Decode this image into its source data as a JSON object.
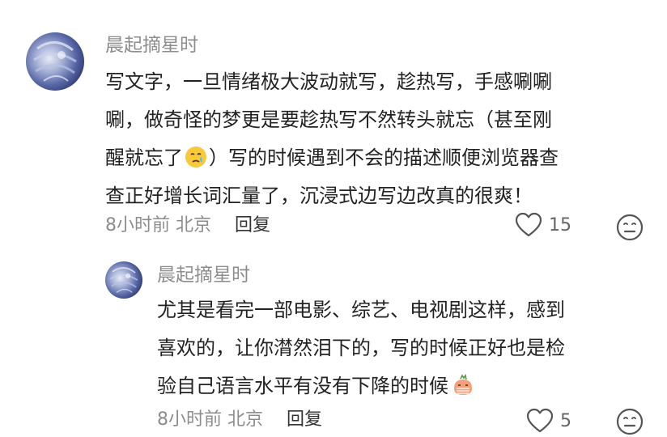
{
  "comment": {
    "username": "晨起摘星时",
    "text_lines": [
      "写文字，一旦情绪极大波动就写，趁热写，手感唰唰",
      "唰，做奇怪的梦更是要趁热写不然转头就忘（甚至刚",
      "醒就忘了",
      "）写的时候遇到不会的描述顺便浏览器查",
      "查正好增长词汇量了，沉浸式边写边改真的很爽！"
    ],
    "inline_emoji": "crying-face-icon",
    "time": "8小时前",
    "location": "北京",
    "reply_label": "回复",
    "like_count": "15"
  },
  "reply": {
    "username": "晨起摘星时",
    "text_lines": [
      "尤其是看完一部电影、综艺、电视剧这样，感到",
      "喜欢的，让你潸然泪下的，写的时候正好也是检",
      "验自己语言水平有没有下降的时候"
    ],
    "inline_emoji": "embarrassed-face-icon",
    "time": "8小时前",
    "location": "北京",
    "reply_label": "回复",
    "like_count": "5"
  },
  "colors": {
    "username": "#8d8d8d",
    "text": "#222222",
    "meta": "#8d8d8d",
    "emoji_yellow": "#f8c93c"
  }
}
